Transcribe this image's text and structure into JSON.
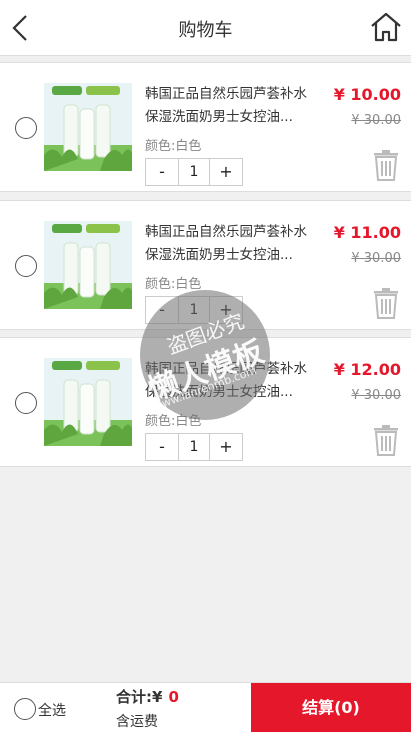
{
  "header": {
    "title": "购物车"
  },
  "items": [
    {
      "name": "韩国正品自然乐园芦荟补水保湿洗面奶男士女控油...",
      "color": "颜色:白色",
      "price": "¥ 10.00",
      "old_price": "¥ 30.00",
      "qty": "1"
    },
    {
      "name": "韩国正品自然乐园芦荟补水保湿洗面奶男士女控油...",
      "color": "颜色:白色",
      "price": "¥ 11.00",
      "old_price": "¥ 30.00",
      "qty": "1"
    },
    {
      "name": "韩国正品自然乐园芦荟补水保湿洗面奶男士女控油...",
      "color": "颜色:白色",
      "price": "¥ 12.00",
      "old_price": "¥ 30.00",
      "qty": "1"
    }
  ],
  "stepper": {
    "minus": "-",
    "plus": "+"
  },
  "footer": {
    "select_all": "全选",
    "total_label": "合计:¥",
    "total_value": "0",
    "shipping": "含运费",
    "checkout": "结算(0)"
  },
  "watermark": {
    "line1": "盗图必究",
    "line2": "懒人模板",
    "line3": "www.lanrenmb.com"
  },
  "colors": {
    "accent": "#e4172b",
    "background": "#f0f0f0"
  }
}
